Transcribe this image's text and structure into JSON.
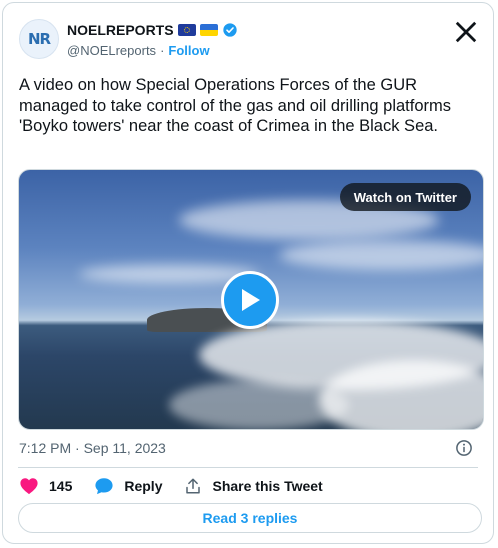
{
  "author": {
    "avatar_text": "NR",
    "display_name": "NOELREPORTS",
    "handle": "@NOELreports",
    "separator": "·",
    "follow_label": "Follow"
  },
  "tweet": {
    "text": "A video on how Special Operations Forces of the GUR managed to take control of the gas and oil drilling platforms 'Boyko towers' near the coast of Crimea in the Black Sea."
  },
  "media": {
    "watch_label": "Watch on Twitter"
  },
  "meta": {
    "timestamp": "7:12 PM · Sep 11, 2023"
  },
  "actions": {
    "like_count": "145",
    "reply_label": "Reply",
    "share_label": "Share this Tweet"
  },
  "read_replies_label": "Read 3 replies",
  "colors": {
    "accent": "#1d9bf0",
    "like": "#f91880",
    "text_primary": "#0f1419",
    "text_secondary": "#536471",
    "border": "#cfd9de"
  },
  "icons": [
    "verified-badge-icon",
    "x-logo-icon",
    "play-icon",
    "info-icon",
    "heart-icon",
    "reply-bubble-icon",
    "share-icon"
  ]
}
